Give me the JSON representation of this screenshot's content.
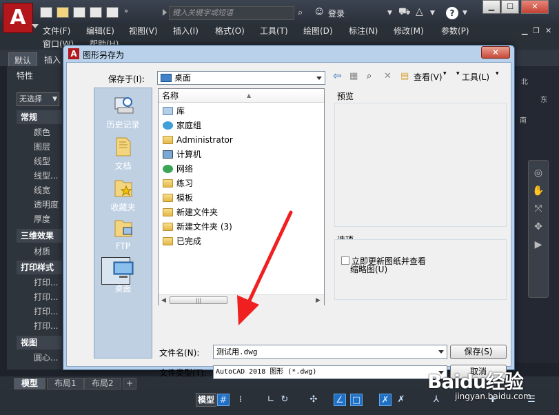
{
  "app": {
    "logo_letter": "A",
    "search_placeholder": "键入关键字或短语",
    "login": "登录",
    "win_min": "▁",
    "win_max": "☐",
    "win_close": "✕"
  },
  "menubar": {
    "items": [
      "文件(F)",
      "编辑(E)",
      "视图(V)",
      "插入(I)",
      "格式(O)",
      "工具(T)",
      "绘图(D)",
      "标注(N)",
      "修改(M)",
      "参数(P)"
    ],
    "row2": [
      "窗口(W)",
      "帮助(H)"
    ]
  },
  "ribbon": {
    "tabs": [
      "默认",
      "插入"
    ]
  },
  "palette": {
    "title": "特性",
    "select_value": "无选择",
    "sections": [
      {
        "title": "常规",
        "items": [
          "颜色",
          "图层",
          "线型",
          "线型...",
          "线宽",
          "透明度",
          "厚度"
        ]
      },
      {
        "title": "三维效果",
        "items": [
          "材质"
        ]
      },
      {
        "title": "打印样式",
        "items": [
          "打印...",
          "打印...",
          "打印...",
          "打印..."
        ]
      },
      {
        "title": "视图",
        "items": [
          "圆心..."
        ]
      }
    ]
  },
  "viewcube": {
    "north": "北",
    "east": "东",
    "south": "南"
  },
  "layout_tabs": [
    "模型",
    "布局1",
    "布局2",
    "+"
  ],
  "statusbar": {
    "model": "模型"
  },
  "watermark": {
    "logo": "Baidu经验",
    "url": "jingyan.baidu.com"
  },
  "dialog": {
    "title": "图形另存为",
    "close": "✕",
    "save_in_label": "保存于(I):",
    "save_in_value": "桌面",
    "toolbar": {
      "view_label": "查看(V)",
      "tools_label": "工具(L)"
    },
    "places": [
      {
        "label": "历史记录"
      },
      {
        "label": "文档"
      },
      {
        "label": "收藏夹"
      },
      {
        "label": "FTP"
      },
      {
        "label": "桌面"
      }
    ],
    "file_list": {
      "column_name": "名称",
      "items": [
        "库",
        "家庭组",
        "Administrator",
        "计算机",
        "网络",
        "练习",
        "模板",
        "新建文件夹",
        "新建文件夹 (3)",
        "已完成"
      ]
    },
    "preview_label": "预览",
    "options_label": "选项",
    "checkbox_label_1": "立即更新图纸并查看",
    "checkbox_label_2": "缩略图(U)",
    "filename_label": "文件名(N):",
    "filename_value": "测试用.dwg",
    "filetype_label": "文件类型(T):",
    "filetype_value": "AutoCAD 2018 图形 (*.dwg)",
    "save_button": "保存(S)",
    "cancel_button": "取消"
  }
}
